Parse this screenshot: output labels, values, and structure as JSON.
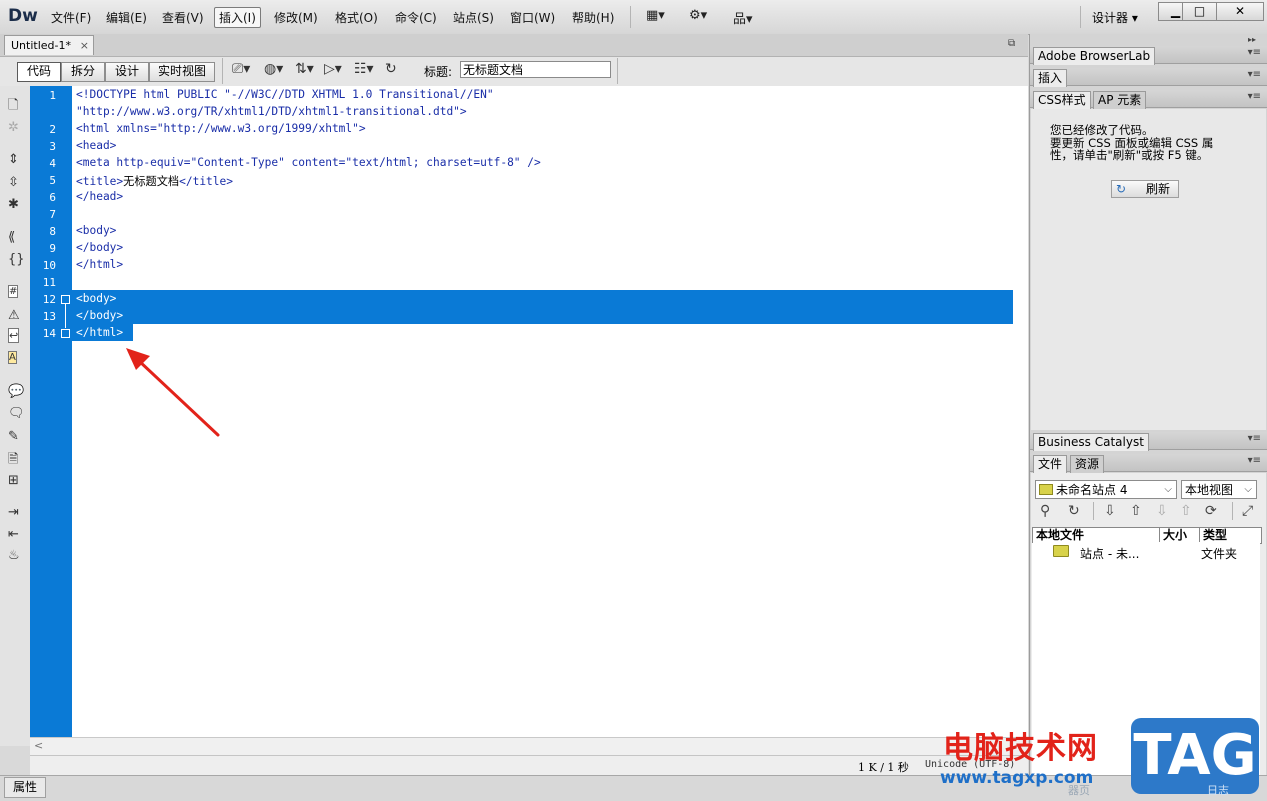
{
  "app": {
    "logo": "Dw",
    "workspace": "设计器 ▾"
  },
  "menu": [
    "文件(F)",
    "编辑(E)",
    "查看(V)",
    "插入(I)",
    "修改(M)",
    "格式(O)",
    "命令(C)",
    "站点(S)",
    "窗口(W)",
    "帮助(H)"
  ],
  "menu_active_index": 3,
  "menubar_icons": [
    "▦▾",
    "⚙▾",
    "品▾"
  ],
  "window_buttons": [
    "▁",
    "□",
    "✕"
  ],
  "document": {
    "tab_label": "Untitled-1*",
    "tab_close": "×",
    "view_buttons": [
      "代码",
      "拆分",
      "设计",
      "实时视图"
    ],
    "active_view": "代码",
    "title_label": "标题:",
    "title_value": "无标题文档"
  },
  "code": {
    "lines": [
      {
        "num": "1",
        "text": "<!DOCTYPE html PUBLIC \"-//W3C//DTD XHTML 1.0 Transitional//EN\""
      },
      {
        "num": "",
        "text": "\"http://www.w3.org/TR/xhtml1/DTD/xhtml1-transitional.dtd\">"
      },
      {
        "num": "2",
        "text": "<html xmlns=\"http://www.w3.org/1999/xhtml\">"
      },
      {
        "num": "3",
        "text": "<head>"
      },
      {
        "num": "4",
        "text": "<meta http-equiv=\"Content-Type\" content=\"text/html; charset=utf-8\" />"
      },
      {
        "num": "5",
        "pre": "<title>",
        "plain": "无标题文档",
        "post": "</title>"
      },
      {
        "num": "6",
        "text": "</head>"
      },
      {
        "num": "7",
        "text": ""
      },
      {
        "num": "8",
        "text": "<body>"
      },
      {
        "num": "9",
        "text": "</body>"
      },
      {
        "num": "10",
        "text": "</html>"
      },
      {
        "num": "11",
        "text": ""
      },
      {
        "num": "12",
        "text": "<body>"
      },
      {
        "num": "13",
        "text": "</body>"
      },
      {
        "num": "14",
        "text": "</html>"
      }
    ]
  },
  "status": {
    "size": "1 K / 1 秒",
    "encoding": "Unicode (UTF-8)"
  },
  "properties_tab": "属性",
  "right_panel": {
    "browserlab_title": "Adobe BrowserLab",
    "insert_tab": "插入",
    "css_tabs": [
      "CSS样式",
      "AP 元素"
    ],
    "css_message": [
      "您已经修改了代码。",
      "要更新 CSS 面板或编辑 CSS 属",
      "性，请单击\"刷新\"或按 F5 键。"
    ],
    "refresh_label": "刷新",
    "business_catalyst": "Business Catalyst",
    "files_tabs": [
      "文件",
      "资源"
    ],
    "site_select": "未命名站点 4",
    "view_select": "本地视图",
    "file_columns": [
      "本地文件",
      "大小",
      "类型"
    ],
    "file_rows": [
      {
        "name": "站点 - 未...",
        "type": "文件夹"
      }
    ],
    "panel_menu_glyph": "▾≡"
  },
  "watermark": {
    "title": "电脑技术网",
    "url": "www.tagxp.com",
    "badge": "TAG",
    "faint_left": "器页",
    "faint_right": "日志"
  },
  "colors": {
    "selection": "#0a7ad6",
    "code_text": "#1a2ea8",
    "watermark_red": "#e2231a",
    "watermark_blue": "#2d79c9"
  }
}
